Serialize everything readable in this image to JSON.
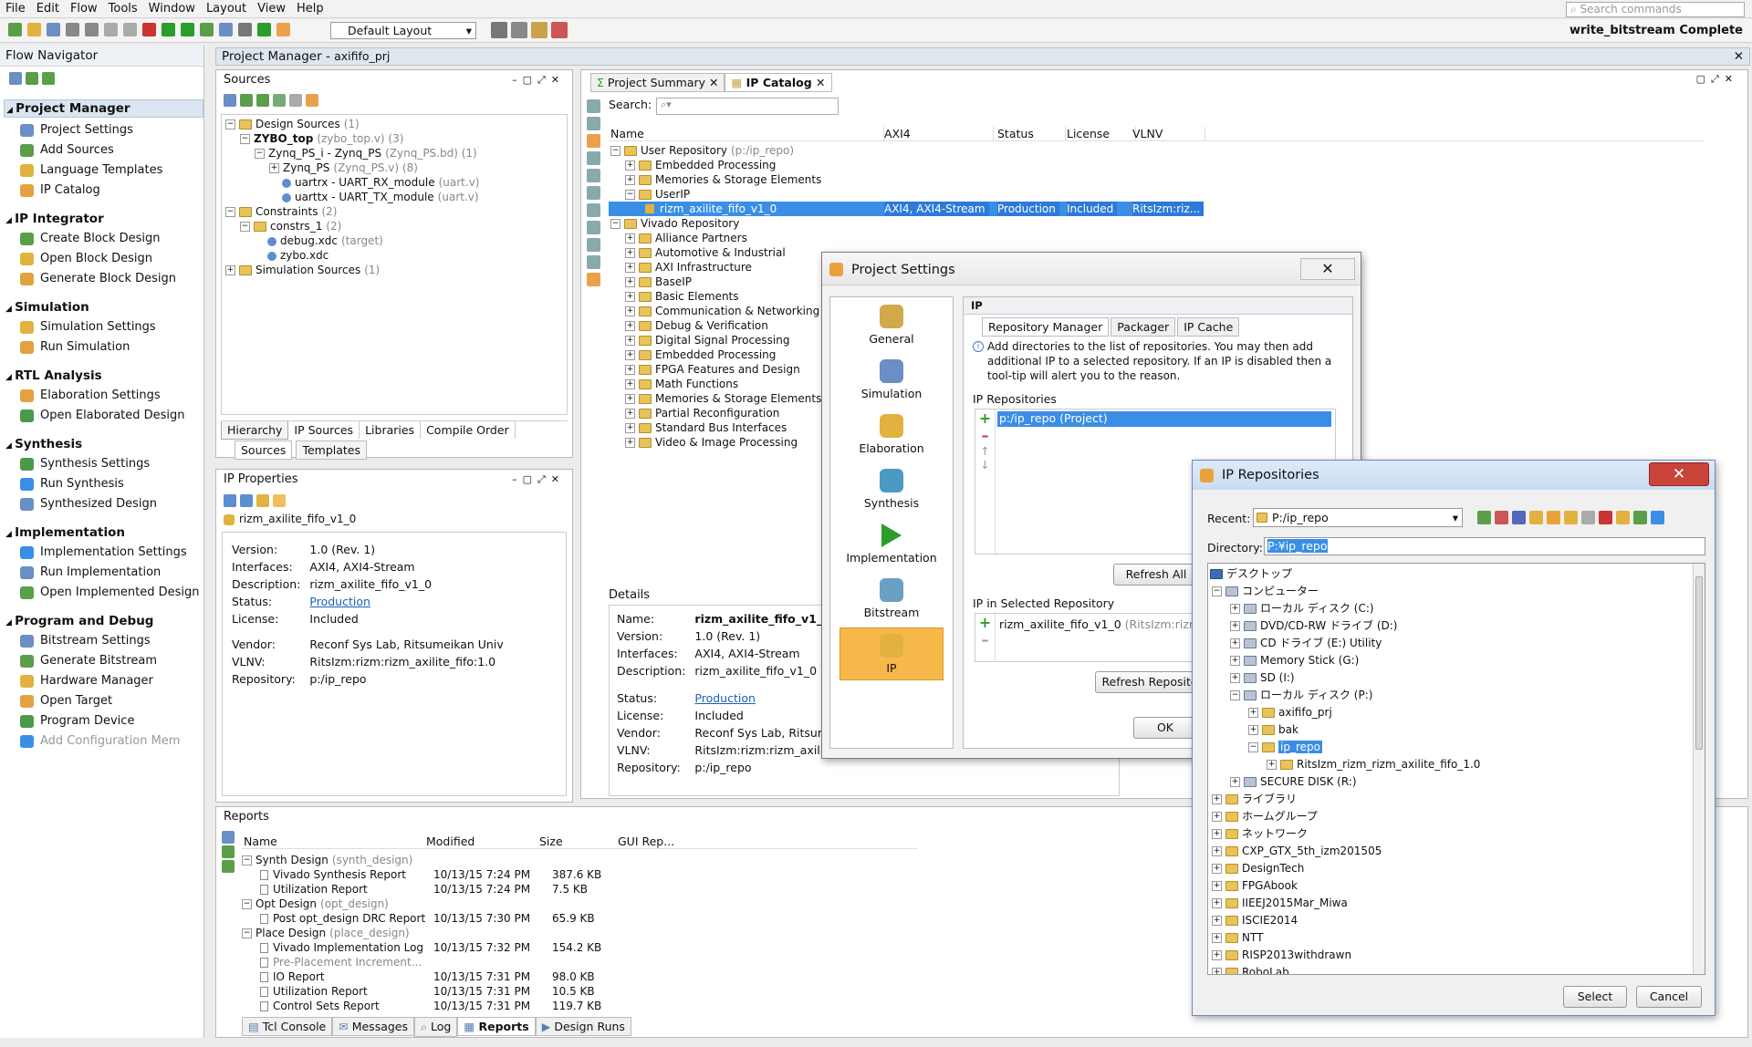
{
  "menu": {
    "items": [
      "File",
      "Edit",
      "Flow",
      "Tools",
      "Window",
      "Layout",
      "View",
      "Help"
    ],
    "search_placeholder": "Search commands"
  },
  "toolbar": {
    "layout": "Default Layout",
    "status": "write_bitstream Complete"
  },
  "flow_nav": {
    "title": "Flow Navigator",
    "sections": [
      {
        "title": "Project Manager",
        "items": [
          "Project Settings",
          "Add Sources",
          "Language Templates",
          "IP Catalog"
        ]
      },
      {
        "title": "IP Integrator",
        "items": [
          "Create Block Design",
          "Open Block Design",
          "Generate Block Design"
        ]
      },
      {
        "title": "Simulation",
        "items": [
          "Simulation Settings",
          "Run Simulation"
        ]
      },
      {
        "title": "RTL Analysis",
        "items": [
          "Elaboration Settings",
          "Open Elaborated Design"
        ]
      },
      {
        "title": "Synthesis",
        "items": [
          "Synthesis Settings",
          "Run Synthesis",
          "Synthesized Design"
        ]
      },
      {
        "title": "Implementation",
        "items": [
          "Implementation Settings",
          "Run Implementation",
          "Open Implemented Design"
        ]
      },
      {
        "title": "Program and Debug",
        "items": [
          "Bitstream Settings",
          "Generate Bitstream",
          "Hardware Manager",
          "Open Target",
          "Program Device",
          "Add Configuration Mem"
        ]
      }
    ]
  },
  "pm": {
    "title": "Project Manager",
    "project": "axififo_prj"
  },
  "sources": {
    "title": "Sources",
    "rows": [
      {
        "t": "Design Sources",
        "d": "(1)"
      },
      {
        "t": "ZYBO_top",
        "d": "(zybo_top.v) (3)"
      },
      {
        "t": "Zynq_PS_i - Zynq_PS",
        "d": "(Zynq_PS.bd) (1)"
      },
      {
        "t": "Zynq_PS",
        "d": "(Zynq_PS.v) (8)"
      },
      {
        "t": "uartrx - UART_RX_module",
        "d": "(uart.v)"
      },
      {
        "t": "uarttx - UART_TX_module",
        "d": "(uart.v)"
      },
      {
        "t": "Constraints",
        "d": "(2)"
      },
      {
        "t": "constrs_1",
        "d": "(2)"
      },
      {
        "t": "debug.xdc",
        "d": "(target)"
      },
      {
        "t": "zybo.xdc",
        "d": ""
      },
      {
        "t": "Simulation Sources",
        "d": "(1)"
      }
    ],
    "tabs": [
      "Hierarchy",
      "IP Sources",
      "Libraries",
      "Compile Order"
    ],
    "subtabs": [
      "Sources",
      "Templates"
    ]
  },
  "ipprops": {
    "title": "IP Properties",
    "name": "rizm_axilite_fifo_v1_0",
    "rows": [
      [
        "Version:",
        "1.0 (Rev. 1)"
      ],
      [
        "Interfaces:",
        "AXI4, AXI4-Stream"
      ],
      [
        "Description:",
        "rizm_axilite_fifo_v1_0"
      ],
      [
        "Status:",
        "Production"
      ],
      [
        "License:",
        "Included"
      ],
      [
        "Vendor:",
        "Reconf Sys Lab, Ritsumeikan Univ"
      ],
      [
        "VLNV:",
        "RitsIzm:rizm:rizm_axilite_fifo:1.0"
      ],
      [
        "Repository:",
        "p:/ip_repo"
      ]
    ]
  },
  "catalog": {
    "tabs": [
      "Project Summary",
      "IP Catalog"
    ],
    "search_label": "Search:",
    "cols": [
      "Name",
      "AXI4",
      "Status",
      "License",
      "VLNV"
    ],
    "user": [
      "User Repository",
      "(p:/ip_repo)"
    ],
    "user_items": [
      "Embedded Processing",
      "Memories & Storage Elements",
      "UserIP"
    ],
    "selected": [
      "rizm_axilite_fifo_v1_0",
      "AXI4, AXI4-Stream",
      "Production",
      "Included",
      "RitsIzm:riz..."
    ],
    "vivado": "Vivado Repository",
    "vivado_items": [
      "Alliance Partners",
      "Automotive & Industrial",
      "AXI Infrastructure",
      "BaseIP",
      "Basic Elements",
      "Communication & Networking",
      "Debug & Verification",
      "Digital Signal Processing",
      "Embedded Processing",
      "FPGA Features and Design",
      "Math Functions",
      "Memories & Storage Elements",
      "Partial Reconfiguration",
      "Standard Bus Interfaces",
      "Video & Image Processing"
    ],
    "details_title": "Details",
    "details": [
      [
        "Name:",
        "rizm_axilite_fifo_v1_0"
      ],
      [
        "Version:",
        "1.0 (Rev. 1)"
      ],
      [
        "Interfaces:",
        "AXI4, AXI4-Stream"
      ],
      [
        "Description:",
        "rizm_axilite_fifo_v1_0"
      ],
      [
        "Status:",
        "Production"
      ],
      [
        "License:",
        "Included"
      ],
      [
        "Vendor:",
        "Reconf Sys Lab, Ritsumei"
      ],
      [
        "VLNV:",
        "RitsIzm:rizm:rizm_axilite_fifo:1.0"
      ],
      [
        "Repository:",
        "p:/ip_repo"
      ]
    ]
  },
  "settings": {
    "title": "Project Settings",
    "cats": [
      "General",
      "Simulation",
      "Elaboration",
      "Synthesis",
      "Implementation",
      "Bitstream",
      "IP"
    ],
    "ip_header": "IP",
    "tabs": [
      "Repository Manager",
      "Packager",
      "IP Cache"
    ],
    "info": "Add directories to the list of repositories. You may then add additional IP to a selected repository. If an IP is disabled then a tool-tip will alert you to the reason.",
    "repos_label": "IP Repositories",
    "repo": "p:/ip_repo (Project)",
    "refresh_all": "Refresh All",
    "in_repo_label": "IP in Selected Repository",
    "in_repo_item": "rizm_axilite_fifo_v1_0",
    "in_repo_dim": "(RitsIzm:rizm:riz",
    "refresh_repo": "Refresh Reposito",
    "ok": "OK"
  },
  "iprepo": {
    "title": "IP Repositories",
    "recent_label": "Recent:",
    "recent": "P:/ip_repo",
    "dir_label": "Directory:",
    "dir": "P:¥ip_repo",
    "tree": [
      {
        "l": 0,
        "t": "デスクトップ"
      },
      {
        "l": 1,
        "t": "コンピューター"
      },
      {
        "l": 2,
        "t": "ローカル ディスク (C:)"
      },
      {
        "l": 2,
        "t": "DVD/CD-RW ドライブ (D:)"
      },
      {
        "l": 2,
        "t": "CD ドライブ (E:) Utility"
      },
      {
        "l": 2,
        "t": "Memory Stick (G:)"
      },
      {
        "l": 2,
        "t": "SD (I:)"
      },
      {
        "l": 2,
        "t": "ローカル ディスク (P:)"
      },
      {
        "l": 3,
        "t": "axififo_prj"
      },
      {
        "l": 3,
        "t": "bak"
      },
      {
        "l": 3,
        "t": "ip_repo"
      },
      {
        "l": 4,
        "t": "RitsIzm_rizm_rizm_axilite_fifo_1.0"
      },
      {
        "l": 2,
        "t": "SECURE DISK (R:)"
      },
      {
        "l": 1,
        "t": "ライブラリ"
      },
      {
        "l": 1,
        "t": "ホームグループ"
      },
      {
        "l": 1,
        "t": "ネットワーク"
      },
      {
        "l": 1,
        "t": "CXP_GTX_5th_izm201505"
      },
      {
        "l": 1,
        "t": "DesignTech"
      },
      {
        "l": 1,
        "t": "FPGAbook"
      },
      {
        "l": 1,
        "t": "IIEEJ2015Mar_Miwa"
      },
      {
        "l": 1,
        "t": "ISCIE2014"
      },
      {
        "l": 1,
        "t": "NTT"
      },
      {
        "l": 1,
        "t": "RISP2013withdrawn"
      },
      {
        "l": 1,
        "t": "RoboLab"
      }
    ],
    "select": "Select",
    "cancel": "Cancel"
  },
  "reports": {
    "title": "Reports",
    "cols": [
      "Name",
      "Modified",
      "Size",
      "GUI Rep..."
    ],
    "rows": [
      {
        "g": true,
        "t": "Synth Design",
        "d": "(synth_design)"
      },
      {
        "t": "Vivado Synthesis Report",
        "m": "10/13/15 7:24 PM",
        "s": "387.6 KB"
      },
      {
        "t": "Utilization Report",
        "m": "10/13/15 7:24 PM",
        "s": "7.5 KB"
      },
      {
        "g": true,
        "t": "Opt Design",
        "d": "(opt_design)"
      },
      {
        "t": "Post opt_design DRC Report",
        "m": "10/13/15 7:30 PM",
        "s": "65.9 KB"
      },
      {
        "g": true,
        "t": "Place Design",
        "d": "(place_design)"
      },
      {
        "t": "Vivado Implementation Log",
        "m": "10/13/15 7:32 PM",
        "s": "154.2 KB"
      },
      {
        "t": "Pre-Placement Increment...",
        "m": "",
        "s": "",
        "dim": true
      },
      {
        "t": "IO Report",
        "m": "10/13/15 7:31 PM",
        "s": "98.0 KB"
      },
      {
        "t": "Utilization Report",
        "m": "10/13/15 7:31 PM",
        "s": "10.5 KB"
      },
      {
        "t": "Control Sets Report",
        "m": "10/13/15 7:31 PM",
        "s": "119.7 KB"
      }
    ],
    "bottom_tabs": [
      "Tcl Console",
      "Messages",
      "Log",
      "Reports",
      "Design Runs"
    ]
  }
}
